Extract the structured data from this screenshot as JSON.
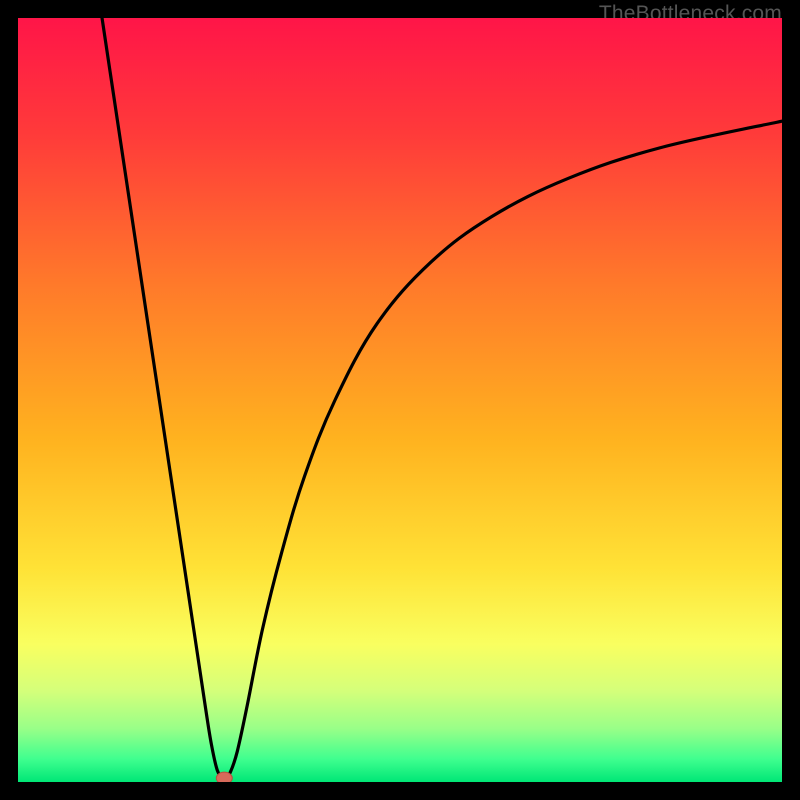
{
  "watermark": "TheBottleneck.com",
  "colors": {
    "frame": "#000000",
    "curve": "#000000",
    "marker_fill": "#d66a5a",
    "marker_stroke": "#b84f3e",
    "gradient_stops": [
      {
        "offset": 0.0,
        "color": "#ff1548"
      },
      {
        "offset": 0.15,
        "color": "#ff3a3a"
      },
      {
        "offset": 0.35,
        "color": "#ff7a2a"
      },
      {
        "offset": 0.55,
        "color": "#ffb21f"
      },
      {
        "offset": 0.72,
        "color": "#ffe236"
      },
      {
        "offset": 0.82,
        "color": "#f9ff60"
      },
      {
        "offset": 0.88,
        "color": "#d5ff7a"
      },
      {
        "offset": 0.93,
        "color": "#99ff88"
      },
      {
        "offset": 0.97,
        "color": "#3fff8f"
      },
      {
        "offset": 1.0,
        "color": "#00e676"
      }
    ]
  },
  "chart_data": {
    "type": "line",
    "title": "",
    "xlabel": "",
    "ylabel": "",
    "xlim": [
      0,
      100
    ],
    "ylim": [
      0,
      100
    ],
    "grid": false,
    "marker": {
      "x": 27,
      "y": 0.5
    },
    "left_branch": [
      {
        "x": 11.0,
        "y": 100.0
      },
      {
        "x": 12.5,
        "y": 90.0
      },
      {
        "x": 14.0,
        "y": 80.0
      },
      {
        "x": 15.5,
        "y": 70.0
      },
      {
        "x": 17.0,
        "y": 60.0
      },
      {
        "x": 18.5,
        "y": 50.0
      },
      {
        "x": 20.0,
        "y": 40.0
      },
      {
        "x": 21.5,
        "y": 30.0
      },
      {
        "x": 23.0,
        "y": 20.0
      },
      {
        "x": 24.5,
        "y": 10.0
      },
      {
        "x": 25.3,
        "y": 5.0
      },
      {
        "x": 26.1,
        "y": 1.5
      },
      {
        "x": 27.0,
        "y": 0.2
      }
    ],
    "right_branch": [
      {
        "x": 27.0,
        "y": 0.2
      },
      {
        "x": 27.8,
        "y": 1.3
      },
      {
        "x": 28.7,
        "y": 4.0
      },
      {
        "x": 30.0,
        "y": 10.0
      },
      {
        "x": 32.0,
        "y": 20.0
      },
      {
        "x": 34.5,
        "y": 30.0
      },
      {
        "x": 37.5,
        "y": 40.0
      },
      {
        "x": 41.5,
        "y": 50.0
      },
      {
        "x": 47.0,
        "y": 60.0
      },
      {
        "x": 54.0,
        "y": 68.0
      },
      {
        "x": 62.0,
        "y": 74.0
      },
      {
        "x": 72.0,
        "y": 79.0
      },
      {
        "x": 84.0,
        "y": 83.0
      },
      {
        "x": 100.0,
        "y": 86.5
      }
    ]
  }
}
